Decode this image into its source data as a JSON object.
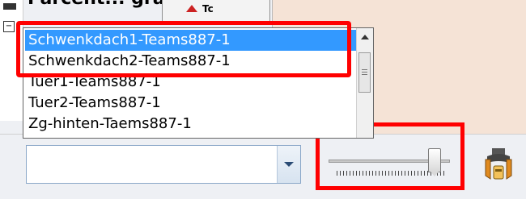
{
  "header": {
    "partial_title": "Parcent... gramming"
  },
  "top_tab": {
    "label": "Tc"
  },
  "list": {
    "items": [
      {
        "label": "Schwenkdach1-Teams887-1",
        "selected": true
      },
      {
        "label": "Schwenkdach2-Teams887-1",
        "selected": false
      },
      {
        "label": "Tuer1-Teams887-1",
        "selected": false
      },
      {
        "label": "Tuer2-Teams887-1",
        "selected": false
      },
      {
        "label": "Zg-hinten-Taems887-1",
        "selected": false
      }
    ]
  },
  "dropdown": {
    "value": ""
  },
  "slider": {
    "value_fraction": 0.92
  },
  "icons": {
    "gripper": "robot-gripper-icon",
    "tree_toggle": "minus-box-icon"
  },
  "colors": {
    "highlight": "#ff0000",
    "selection": "#3399ff",
    "panel": "#f5e3d6"
  }
}
